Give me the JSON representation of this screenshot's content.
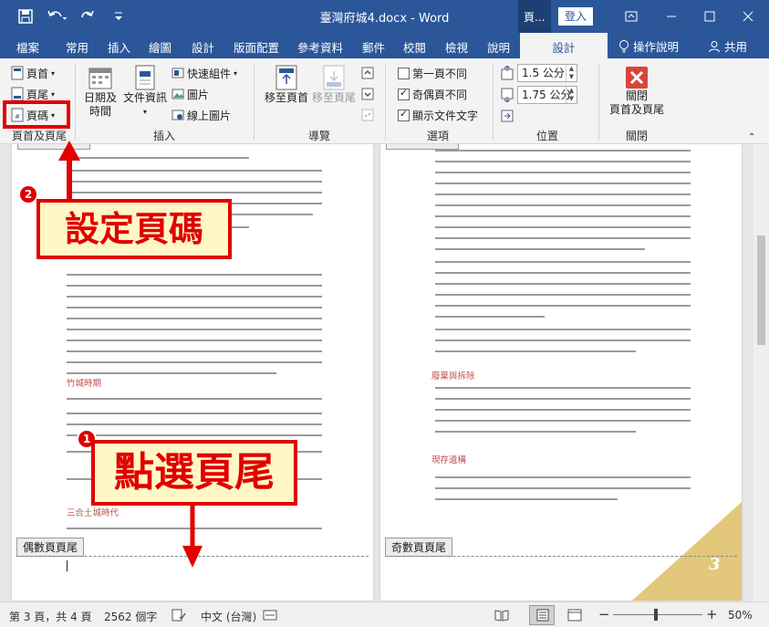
{
  "window": {
    "doc_title": "臺灣府城4.docx - Word",
    "context_tab_top": "頁...",
    "login_label": "登入"
  },
  "tabs": {
    "items": [
      "檔案",
      "常用",
      "插入",
      "繪圖",
      "設計",
      "版面配置",
      "參考資料",
      "郵件",
      "校閱",
      "檢視",
      "說明"
    ],
    "context_tab": "設計",
    "tell_me": "操作說明",
    "share": "共用"
  },
  "ribbon": {
    "header_footer": {
      "header": "頁首",
      "footer": "頁尾",
      "page_number": "頁碼",
      "group_label": "頁首及頁尾"
    },
    "insert": {
      "date_time_line1": "日期及",
      "date_time_line2": "時間",
      "doc_info_line1": "文件資訊",
      "quick_parts": "快速組件",
      "pictures": "圖片",
      "online_pictures": "線上圖片",
      "group_label": "插入"
    },
    "navigation": {
      "goto_header": "移至頁首",
      "goto_footer": "移至頁尾",
      "group_label": "導覽"
    },
    "options": {
      "different_first": "第一頁不同",
      "different_odd_even": "奇偶頁不同",
      "show_document_text": "顯示文件文字",
      "group_label": "選項"
    },
    "position": {
      "header_from_top": "1.5 公分",
      "footer_from_bottom": "1.75 公分",
      "group_label": "位置"
    },
    "close": {
      "close_line1": "關閉",
      "close_line2": "頁首及頁尾",
      "group_label": "關閉"
    }
  },
  "document": {
    "left_page": {
      "headings": [
        "竹城時期",
        "三合土城時代"
      ],
      "footer_tag": "偶數頁頁尾"
    },
    "right_page": {
      "headings": [
        "廢棄與拆除",
        "現存遺構"
      ],
      "footer_tag": "奇數頁頁尾",
      "page_number_mark": "3"
    }
  },
  "annotations": {
    "step1_number": "1",
    "step1_text": "點選頁尾",
    "step2_number": "2",
    "step2_text": "設定頁碼"
  },
  "statusbar": {
    "page": "第 3 頁，共 4 頁",
    "words": "2562 個字",
    "language": "中文 (台灣)",
    "zoom": "50%"
  },
  "colors": {
    "accent": "#2b579a",
    "annotation_red": "#e00000",
    "annotation_fill": "#fff8c6",
    "heading_red": "#c0504d",
    "corner_gold": "#e3c77a"
  }
}
